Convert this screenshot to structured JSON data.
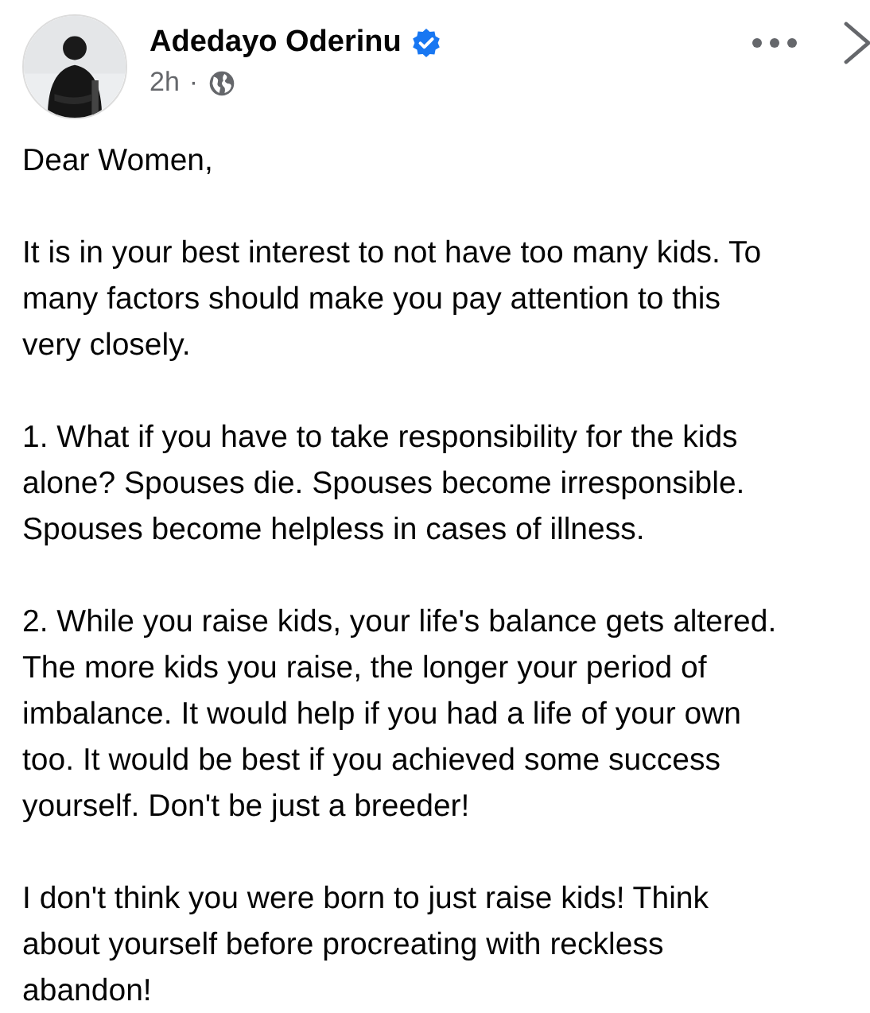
{
  "post": {
    "author": "Adedayo Oderinu",
    "verified": true,
    "time": "2h",
    "separator": "·",
    "paragraphs": [
      "Dear Women,",
      "It is in your best interest to not have too many kids. To\nmany factors should make you pay attention to this\nvery closely.",
      "1. What if you have to take responsibility for the kids\nalone? Spouses die. Spouses become irresponsible.\nSpouses become helpless in cases of illness.",
      "2. While you raise kids, your life's balance gets altered.\nThe more kids you raise, the longer your period of\nimbalance. It would help if you had a life of your own\ntoo. It would be best if you achieved some success\nyourself. Don't be just a breeder!",
      "I don't think you were born to just raise kids! Think\nabout yourself before procreating with reckless\nabandon!"
    ]
  }
}
